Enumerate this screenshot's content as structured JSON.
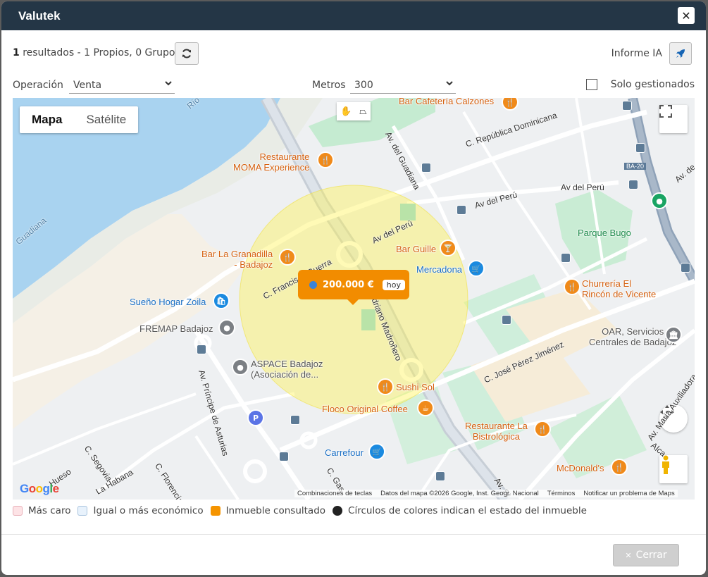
{
  "window": {
    "title": "Valutek"
  },
  "results": {
    "count": "1",
    "text": " resultados - 1 Propios, 0 Grupo"
  },
  "informe": {
    "label": "Informe IA"
  },
  "filters": {
    "operacion_label": "Operación",
    "operacion_value": "Venta",
    "metros_label": "Metros",
    "metros_value": "300",
    "solo_label": "Solo gestionados",
    "solo_checked": false
  },
  "map": {
    "maptype": {
      "map": "Mapa",
      "satellite": "Satélite"
    },
    "price_marker": {
      "price": "200.000 €",
      "tag": "hoy"
    },
    "places": [
      {
        "id": "bar-cafeteria",
        "name": "Bar Cafetería Calzones"
      },
      {
        "id": "restaurante-moma",
        "name": "Restaurante\nMOMA Experience"
      },
      {
        "id": "bar-granadilla",
        "name": "Bar La Granadilla\n- Badajoz"
      },
      {
        "id": "bar-guille",
        "name": "Bar Guille"
      },
      {
        "id": "mercadona",
        "name": "Mercadona"
      },
      {
        "id": "sueno-hogar",
        "name": "Sueño Hogar Zoila"
      },
      {
        "id": "fremap",
        "name": "FREMAP Badajoz"
      },
      {
        "id": "aspace",
        "name": "ASPACE Badajoz\n(Asociación de..."
      },
      {
        "id": "sushi-sol",
        "name": "Sushi Sol"
      },
      {
        "id": "floco",
        "name": "Floco Original Coffee"
      },
      {
        "id": "carrefour",
        "name": "Carrefour"
      },
      {
        "id": "parque-bugo",
        "name": "Parque Bugo"
      },
      {
        "id": "churreria",
        "name": "Churrería El\nRincón de Vicente"
      },
      {
        "id": "oar",
        "name": "OAR, Servicios\nCentrales de Badajoz"
      },
      {
        "id": "restaurante-bistrologica",
        "name": "Restaurante La\nBistrológica"
      },
      {
        "id": "mcdonalds",
        "name": "McDonald's"
      }
    ],
    "streets": [
      {
        "id": "rep-dominicana",
        "name": "C. República Dominicana"
      },
      {
        "id": "av-guadiana",
        "name": "Av. del Guadiana"
      },
      {
        "id": "av-peru-1",
        "name": "Av del Perú"
      },
      {
        "id": "av-peru-2",
        "name": "Av del Perú"
      },
      {
        "id": "av-peru-3",
        "name": "Av del Perú"
      },
      {
        "id": "francisco-guerra",
        "name": "C. Francisco Guerra"
      },
      {
        "id": "adriano-madronero",
        "name": "Adriano Madroñero"
      },
      {
        "id": "jose-perez-jimenez",
        "name": "C. José Pérez Jiménez"
      },
      {
        "id": "av-principe",
        "name": "Av. Príncipe de Asturias"
      },
      {
        "id": "c-segovia",
        "name": "C. Segovia"
      },
      {
        "id": "la-habana",
        "name": "La Habana"
      },
      {
        "id": "c-florencia",
        "name": "C. Florencia"
      },
      {
        "id": "hueso",
        "name": "Hueso"
      },
      {
        "id": "c-gas",
        "name": "C. Gas"
      },
      {
        "id": "av-si",
        "name": "Av. Si"
      },
      {
        "id": "av-maria-aux",
        "name": "Av. María Auxiliadora"
      },
      {
        "id": "alca",
        "name": "Alca"
      },
      {
        "id": "av-right",
        "name": "Av. de"
      },
      {
        "id": "rio",
        "name": "Río"
      },
      {
        "id": "guadiana-river",
        "name": "Guadiana"
      },
      {
        "id": "ba20",
        "name": "BA-20"
      }
    ],
    "attribution": {
      "keys": "Combinaciones de teclas",
      "data": "Datos del mapa ©2026 Google, Inst. Geogr. Nacional",
      "terms": "Términos",
      "report": "Notificar un problema de Maps"
    },
    "google_logo": "Google"
  },
  "legend": [
    {
      "label": "Más caro",
      "color": "#fde3e6",
      "border": "#e8b0b8"
    },
    {
      "label": "Igual o más económico",
      "color": "#e8f2fc",
      "border": "#a9c4de"
    },
    {
      "label": "Inmueble consultado",
      "color": "#f59400",
      "border": "#f59400"
    },
    {
      "label": "Círculos de colores indican el estado del inmueble",
      "color": "#222222",
      "border": "#222222"
    }
  ],
  "footer": {
    "close_label": "Cerrar"
  }
}
